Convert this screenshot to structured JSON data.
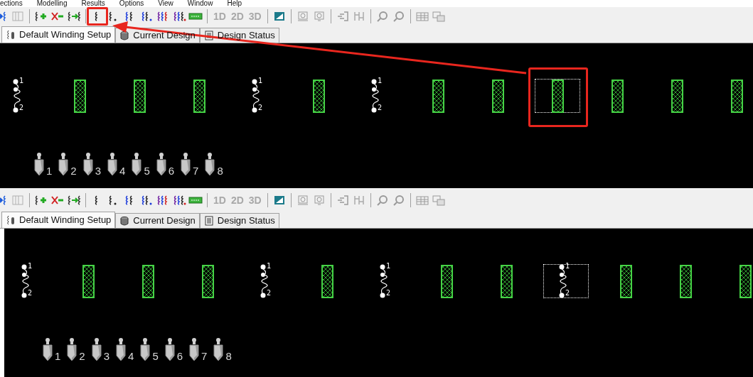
{
  "menu_bar": [
    "ections",
    "Modelling",
    "Results",
    "Options",
    "View",
    "Window",
    "Help"
  ],
  "panels": [
    {
      "view_buttons": [
        {
          "label": "1D",
          "disabled": true
        },
        {
          "label": "2D",
          "disabled": true
        },
        {
          "label": "3D",
          "disabled": true
        }
      ],
      "tabs": [
        {
          "label": "Default Winding Setup",
          "selected": true
        },
        {
          "label": "Current Design",
          "selected": false
        },
        {
          "label": "Design Status",
          "selected": false
        }
      ],
      "slots": [
        {
          "kind": "coil",
          "selected": false,
          "terminals": [
            "1",
            "2"
          ]
        },
        {
          "kind": "empty",
          "selected": false
        },
        {
          "kind": "empty",
          "selected": false
        },
        {
          "kind": "empty",
          "selected": false
        },
        {
          "kind": "coil",
          "selected": false,
          "terminals": [
            "1",
            "2"
          ]
        },
        {
          "kind": "empty",
          "selected": false
        },
        {
          "kind": "coil",
          "selected": false,
          "terminals": [
            "1",
            "2"
          ]
        },
        {
          "kind": "empty",
          "selected": false
        },
        {
          "kind": "empty",
          "selected": false
        },
        {
          "kind": "empty",
          "selected": true
        },
        {
          "kind": "empty",
          "selected": false
        },
        {
          "kind": "empty",
          "selected": false
        },
        {
          "kind": "empty",
          "selected": false
        }
      ],
      "connections": [
        "1",
        "2",
        "3",
        "4",
        "5",
        "6",
        "7",
        "8"
      ]
    },
    {
      "view_buttons": [
        {
          "label": "1D",
          "disabled": true
        },
        {
          "label": "2D",
          "disabled": true
        },
        {
          "label": "3D",
          "disabled": true
        }
      ],
      "tabs": [
        {
          "label": "Default Winding Setup",
          "selected": true
        },
        {
          "label": "Current Design",
          "selected": false
        },
        {
          "label": "Design Status",
          "selected": false
        }
      ],
      "slots": [
        {
          "kind": "coil",
          "selected": false,
          "terminals": [
            "1",
            "2"
          ]
        },
        {
          "kind": "empty",
          "selected": false
        },
        {
          "kind": "empty",
          "selected": false
        },
        {
          "kind": "empty",
          "selected": false
        },
        {
          "kind": "coil",
          "selected": false,
          "terminals": [
            "1",
            "2"
          ]
        },
        {
          "kind": "empty",
          "selected": false
        },
        {
          "kind": "coil",
          "selected": false,
          "terminals": [
            "1",
            "2"
          ]
        },
        {
          "kind": "empty",
          "selected": false
        },
        {
          "kind": "empty",
          "selected": false
        },
        {
          "kind": "coil",
          "selected": true,
          "terminals": [
            "1",
            "2"
          ]
        },
        {
          "kind": "empty",
          "selected": false
        },
        {
          "kind": "empty",
          "selected": false
        },
        {
          "kind": "empty",
          "selected": false
        }
      ],
      "connections": [
        "1",
        "2",
        "3",
        "4",
        "5",
        "6",
        "7",
        "8"
      ]
    }
  ]
}
